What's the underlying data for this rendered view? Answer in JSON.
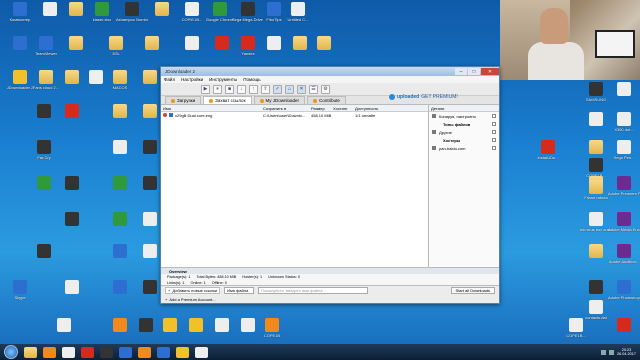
{
  "desktop_icons": [
    {
      "label": "Компьютер",
      "color": "blue",
      "l": 4,
      "t": 2
    },
    {
      "label": "",
      "color": "white",
      "l": 34,
      "t": 2
    },
    {
      "label": "",
      "color": "folder",
      "l": 60,
      "t": 2
    },
    {
      "label": "klaser.xlsx",
      "color": "green",
      "l": 86,
      "t": 2
    },
    {
      "label": "Ashampoo Burning...",
      "color": "dark",
      "l": 116,
      "t": 2
    },
    {
      "label": "",
      "color": "folder",
      "l": 146,
      "t": 2
    },
    {
      "label": "COPIE1B...",
      "color": "white",
      "l": 176,
      "t": 2
    },
    {
      "label": "Google Chrome",
      "color": "green",
      "l": 204,
      "t": 2
    },
    {
      "label": "Sega Mega Drive PC...",
      "color": "dark",
      "l": 232,
      "t": 2
    },
    {
      "label": "FiboTips",
      "color": "blue",
      "l": 258,
      "t": 2
    },
    {
      "label": "Untitled C...",
      "color": "white",
      "l": 282,
      "t": 2
    },
    {
      "label": "",
      "color": "blue",
      "l": 4,
      "t": 36
    },
    {
      "label": "TeamViewer",
      "color": "blue",
      "l": 30,
      "t": 36
    },
    {
      "label": "",
      "color": "folder",
      "l": 60,
      "t": 36
    },
    {
      "label": "3GL",
      "color": "folder",
      "l": 100,
      "t": 36
    },
    {
      "label": "",
      "color": "folder",
      "l": 136,
      "t": 36
    },
    {
      "label": "",
      "color": "white",
      "l": 176,
      "t": 36
    },
    {
      "label": "",
      "color": "red",
      "l": 206,
      "t": 36
    },
    {
      "label": "Yandex",
      "color": "red",
      "l": 232,
      "t": 36
    },
    {
      "label": "",
      "color": "white",
      "l": 258,
      "t": 36
    },
    {
      "label": "",
      "color": "folder",
      "l": 284,
      "t": 36
    },
    {
      "label": "",
      "color": "folder",
      "l": 308,
      "t": 36
    },
    {
      "label": "JDownloader 2",
      "color": "yellow",
      "l": 4,
      "t": 70
    },
    {
      "label": "Fans cloud 2...",
      "color": "folder",
      "l": 30,
      "t": 70
    },
    {
      "label": "",
      "color": "folder",
      "l": 56,
      "t": 70
    },
    {
      "label": "",
      "color": "white",
      "l": 80,
      "t": 70
    },
    {
      "label": "MACOS",
      "color": "folder",
      "l": 104,
      "t": 70
    },
    {
      "label": "",
      "color": "folder",
      "l": 134,
      "t": 70
    },
    {
      "label": "",
      "color": "dark",
      "l": 28,
      "t": 104
    },
    {
      "label": "",
      "color": "red",
      "l": 56,
      "t": 104
    },
    {
      "label": "",
      "color": "folder",
      "l": 104,
      "t": 104
    },
    {
      "label": "",
      "color": "folder",
      "l": 134,
      "t": 104
    },
    {
      "label": "Far Cry",
      "color": "dark",
      "l": 28,
      "t": 140
    },
    {
      "label": "",
      "color": "white",
      "l": 104,
      "t": 140
    },
    {
      "label": "",
      "color": "dark",
      "l": 134,
      "t": 140
    },
    {
      "label": "",
      "color": "green",
      "l": 28,
      "t": 176
    },
    {
      "label": "",
      "color": "dark",
      "l": 56,
      "t": 176
    },
    {
      "label": "",
      "color": "green",
      "l": 104,
      "t": 176
    },
    {
      "label": "",
      "color": "dark",
      "l": 134,
      "t": 176
    },
    {
      "label": "",
      "color": "dark",
      "l": 56,
      "t": 212
    },
    {
      "label": "",
      "color": "green",
      "l": 104,
      "t": 212
    },
    {
      "label": "",
      "color": "white",
      "l": 134,
      "t": 212
    },
    {
      "label": "",
      "color": "dark",
      "l": 28,
      "t": 244
    },
    {
      "label": "",
      "color": "blue",
      "l": 104,
      "t": 244
    },
    {
      "label": "",
      "color": "white",
      "l": 134,
      "t": 244
    },
    {
      "label": "Skype",
      "color": "blue",
      "l": 4,
      "t": 280
    },
    {
      "label": "",
      "color": "white",
      "l": 56,
      "t": 280
    },
    {
      "label": "",
      "color": "blue",
      "l": 104,
      "t": 280
    },
    {
      "label": "",
      "color": "dark",
      "l": 134,
      "t": 280
    },
    {
      "label": "",
      "color": "white",
      "l": 48,
      "t": 318
    },
    {
      "label": "",
      "color": "orange",
      "l": 104,
      "t": 318
    },
    {
      "label": "",
      "color": "dark",
      "l": 130,
      "t": 318
    },
    {
      "label": "",
      "color": "yellow",
      "l": 154,
      "t": 318
    },
    {
      "label": "",
      "color": "yellow",
      "l": 180,
      "t": 318
    },
    {
      "label": "",
      "color": "white",
      "l": 206,
      "t": 318
    },
    {
      "label": "",
      "color": "white",
      "l": 232,
      "t": 318
    },
    {
      "label": "COPE1B",
      "color": "orange",
      "l": 256,
      "t": 318
    },
    {
      "label": "SAMSUNG",
      "color": "dark",
      "l": 580,
      "t": 82
    },
    {
      "label": "",
      "color": "white",
      "l": 608,
      "t": 82
    },
    {
      "label": "",
      "color": "white",
      "l": 580,
      "t": 112
    },
    {
      "label": "X360 dot...",
      "color": "white",
      "l": 608,
      "t": 112
    },
    {
      "label": "",
      "color": "folder",
      "l": 580,
      "t": 140
    },
    {
      "label": "Install-iDu...",
      "color": "red",
      "l": 532,
      "t": 140
    },
    {
      "label": "COPE1B...",
      "color": "dark",
      "l": 580,
      "t": 158
    },
    {
      "label": "Sega Pen...",
      "color": "white",
      "l": 608,
      "t": 140
    },
    {
      "label": "",
      "color": "folder",
      "l": 580,
      "t": 176
    },
    {
      "label": "Frisse rabota",
      "color": "folder",
      "l": 580,
      "t": 180
    },
    {
      "label": "Adobe Premiere P...",
      "color": "purple",
      "l": 608,
      "t": 176
    },
    {
      "label": "mirrorus box crack by N...",
      "color": "white",
      "l": 580,
      "t": 212
    },
    {
      "label": "Adobe Media Encoder CC...",
      "color": "purple",
      "l": 608,
      "t": 212
    },
    {
      "label": "",
      "color": "folder",
      "l": 580,
      "t": 244
    },
    {
      "label": "Adobe Audition...",
      "color": "purple",
      "l": 608,
      "t": 244
    },
    {
      "label": "",
      "color": "dark",
      "l": 580,
      "t": 280
    },
    {
      "label": "Adobe Photoshop 2014",
      "color": "blue",
      "l": 608,
      "t": 280
    },
    {
      "label": "contacts.dat",
      "color": "white",
      "l": 580,
      "t": 300
    },
    {
      "label": "COPE1B...",
      "color": "white",
      "l": 560,
      "t": 318
    },
    {
      "label": "",
      "color": "red",
      "l": 608,
      "t": 318
    }
  ],
  "window": {
    "title": "JDownloader 2",
    "menu": [
      "Файл",
      "Настройки",
      "Инструменты",
      "Помощь"
    ],
    "toolbar": [
      "▶",
      "⏸",
      "■",
      "↓",
      "↑",
      "⇧",
      "✓",
      "⌂",
      "✕",
      "☰",
      "⚙"
    ],
    "tabs": [
      {
        "label": "Загрузки",
        "active": false
      },
      {
        "label": "Захват ссылок",
        "active": true
      },
      {
        "label": "My JDownloader",
        "active": false
      },
      {
        "label": "Contribute",
        "active": false
      }
    ],
    "brand": "uploaded",
    "brand_suffix": "GET PREMIUM!",
    "table_headers": [
      "Имя",
      "Сохранить в",
      "Размер",
      "Хостинг",
      "Доступность"
    ],
    "rows": [
      {
        "name": "x29gB.Dual.core.eng",
        "save_to": "C:\\Users\\user\\Downlo...",
        "size": "458.10 MiB",
        "host": "",
        "status": "1/1 онлайн"
      }
    ],
    "side_header": "Детали",
    "side_rows": [
      {
        "label": "Копируя, настроено",
        "group": false
      },
      {
        "label": "Типы файлов",
        "group": true
      },
      {
        "label": "Другие",
        "group": false
      },
      {
        "label": "Хостеры",
        "group": true
      },
      {
        "label": "pan-baidu.com",
        "group": false
      }
    ],
    "overview": {
      "title": "Overview",
      "items": [
        {
          "k": "Package(s):",
          "v": "1"
        },
        {
          "k": "Total Bytes:",
          "v": "458.10 MiB"
        },
        {
          "k": "Hoster(s):",
          "v": "1"
        },
        {
          "k": "Unknown Status:",
          "v": "0"
        }
      ],
      "items2": [
        {
          "k": "Links(s):",
          "v": "1"
        },
        {
          "k": "Online:",
          "v": "1"
        },
        {
          "k": "Offline:",
          "v": "0"
        }
      ]
    },
    "bottom": {
      "add_links_label": "Добавить новые ссылки",
      "filter_label": "Имя файла",
      "search_placeholder": "Пожалуйста, введите имя файла...",
      "start_button": "Start all Downloads",
      "premium_label": "Add a Premium Account..."
    }
  },
  "taskbar": {
    "apps": [
      "folder",
      "orange",
      "white",
      "red",
      "dark",
      "blue",
      "orange",
      "blue",
      "yellow",
      "white"
    ],
    "time": "20:23",
    "date": "26.04.2017"
  }
}
